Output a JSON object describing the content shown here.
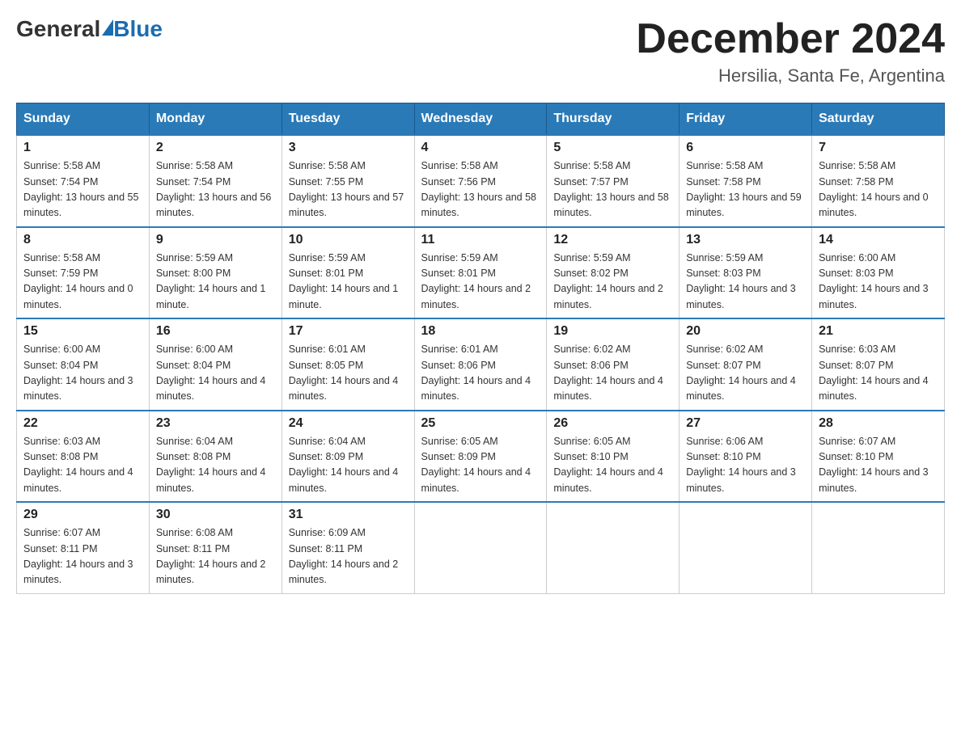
{
  "logo": {
    "general": "General",
    "blue": "Blue"
  },
  "title": "December 2024",
  "location": "Hersilia, Santa Fe, Argentina",
  "days_of_week": [
    "Sunday",
    "Monday",
    "Tuesday",
    "Wednesday",
    "Thursday",
    "Friday",
    "Saturday"
  ],
  "weeks": [
    [
      {
        "day": "1",
        "sunrise": "5:58 AM",
        "sunset": "7:54 PM",
        "daylight": "13 hours and 55 minutes."
      },
      {
        "day": "2",
        "sunrise": "5:58 AM",
        "sunset": "7:54 PM",
        "daylight": "13 hours and 56 minutes."
      },
      {
        "day": "3",
        "sunrise": "5:58 AM",
        "sunset": "7:55 PM",
        "daylight": "13 hours and 57 minutes."
      },
      {
        "day": "4",
        "sunrise": "5:58 AM",
        "sunset": "7:56 PM",
        "daylight": "13 hours and 58 minutes."
      },
      {
        "day": "5",
        "sunrise": "5:58 AM",
        "sunset": "7:57 PM",
        "daylight": "13 hours and 58 minutes."
      },
      {
        "day": "6",
        "sunrise": "5:58 AM",
        "sunset": "7:58 PM",
        "daylight": "13 hours and 59 minutes."
      },
      {
        "day": "7",
        "sunrise": "5:58 AM",
        "sunset": "7:58 PM",
        "daylight": "14 hours and 0 minutes."
      }
    ],
    [
      {
        "day": "8",
        "sunrise": "5:58 AM",
        "sunset": "7:59 PM",
        "daylight": "14 hours and 0 minutes."
      },
      {
        "day": "9",
        "sunrise": "5:59 AM",
        "sunset": "8:00 PM",
        "daylight": "14 hours and 1 minute."
      },
      {
        "day": "10",
        "sunrise": "5:59 AM",
        "sunset": "8:01 PM",
        "daylight": "14 hours and 1 minute."
      },
      {
        "day": "11",
        "sunrise": "5:59 AM",
        "sunset": "8:01 PM",
        "daylight": "14 hours and 2 minutes."
      },
      {
        "day": "12",
        "sunrise": "5:59 AM",
        "sunset": "8:02 PM",
        "daylight": "14 hours and 2 minutes."
      },
      {
        "day": "13",
        "sunrise": "5:59 AM",
        "sunset": "8:03 PM",
        "daylight": "14 hours and 3 minutes."
      },
      {
        "day": "14",
        "sunrise": "6:00 AM",
        "sunset": "8:03 PM",
        "daylight": "14 hours and 3 minutes."
      }
    ],
    [
      {
        "day": "15",
        "sunrise": "6:00 AM",
        "sunset": "8:04 PM",
        "daylight": "14 hours and 3 minutes."
      },
      {
        "day": "16",
        "sunrise": "6:00 AM",
        "sunset": "8:04 PM",
        "daylight": "14 hours and 4 minutes."
      },
      {
        "day": "17",
        "sunrise": "6:01 AM",
        "sunset": "8:05 PM",
        "daylight": "14 hours and 4 minutes."
      },
      {
        "day": "18",
        "sunrise": "6:01 AM",
        "sunset": "8:06 PM",
        "daylight": "14 hours and 4 minutes."
      },
      {
        "day": "19",
        "sunrise": "6:02 AM",
        "sunset": "8:06 PM",
        "daylight": "14 hours and 4 minutes."
      },
      {
        "day": "20",
        "sunrise": "6:02 AM",
        "sunset": "8:07 PM",
        "daylight": "14 hours and 4 minutes."
      },
      {
        "day": "21",
        "sunrise": "6:03 AM",
        "sunset": "8:07 PM",
        "daylight": "14 hours and 4 minutes."
      }
    ],
    [
      {
        "day": "22",
        "sunrise": "6:03 AM",
        "sunset": "8:08 PM",
        "daylight": "14 hours and 4 minutes."
      },
      {
        "day": "23",
        "sunrise": "6:04 AM",
        "sunset": "8:08 PM",
        "daylight": "14 hours and 4 minutes."
      },
      {
        "day": "24",
        "sunrise": "6:04 AM",
        "sunset": "8:09 PM",
        "daylight": "14 hours and 4 minutes."
      },
      {
        "day": "25",
        "sunrise": "6:05 AM",
        "sunset": "8:09 PM",
        "daylight": "14 hours and 4 minutes."
      },
      {
        "day": "26",
        "sunrise": "6:05 AM",
        "sunset": "8:10 PM",
        "daylight": "14 hours and 4 minutes."
      },
      {
        "day": "27",
        "sunrise": "6:06 AM",
        "sunset": "8:10 PM",
        "daylight": "14 hours and 3 minutes."
      },
      {
        "day": "28",
        "sunrise": "6:07 AM",
        "sunset": "8:10 PM",
        "daylight": "14 hours and 3 minutes."
      }
    ],
    [
      {
        "day": "29",
        "sunrise": "6:07 AM",
        "sunset": "8:11 PM",
        "daylight": "14 hours and 3 minutes."
      },
      {
        "day": "30",
        "sunrise": "6:08 AM",
        "sunset": "8:11 PM",
        "daylight": "14 hours and 2 minutes."
      },
      {
        "day": "31",
        "sunrise": "6:09 AM",
        "sunset": "8:11 PM",
        "daylight": "14 hours and 2 minutes."
      },
      null,
      null,
      null,
      null
    ]
  ],
  "labels": {
    "sunrise": "Sunrise:",
    "sunset": "Sunset:",
    "daylight": "Daylight:"
  }
}
